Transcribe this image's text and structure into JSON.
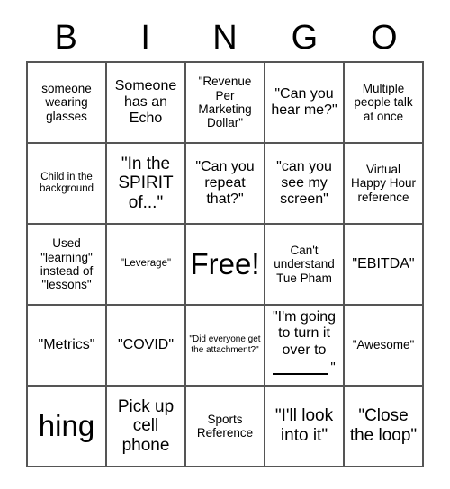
{
  "card": {
    "header_letters": [
      "B",
      "I",
      "N",
      "G",
      "O"
    ],
    "rows": [
      [
        {
          "text": "someone wearing glasses",
          "size": "md"
        },
        {
          "text": "Someone has an Echo",
          "size": "lg"
        },
        {
          "text": "\"Revenue Per Marketing Dollar\"",
          "size": "md"
        },
        {
          "text": "\"Can you hear me?\"",
          "size": "lg"
        },
        {
          "text": "Multiple people talk at once",
          "size": "md"
        }
      ],
      [
        {
          "text": "Child in the background",
          "size": "sm"
        },
        {
          "text": "\"In the SPIRIT of...\"",
          "size": "xl"
        },
        {
          "text": "\"Can you repeat that?\"",
          "size": "lg"
        },
        {
          "text": "\"can you see my screen\"",
          "size": "lg"
        },
        {
          "text": "Virtual Happy Hour reference",
          "size": "md"
        }
      ],
      [
        {
          "text": "Used \"learning\" instead of \"lessons\"",
          "size": "md"
        },
        {
          "text": "\"Leverage\"",
          "size": "sm"
        },
        {
          "text": "Free!",
          "size": "huge"
        },
        {
          "text": "Can't understand Tue Pham",
          "size": "md"
        },
        {
          "text": "\"EBITDA\"",
          "size": "lg"
        }
      ],
      [
        {
          "text": "\"Metrics\"",
          "size": "lg"
        },
        {
          "text": "\"COVID\"",
          "size": "lg"
        },
        {
          "text": "\"Did everyone get the attachment?\"",
          "size": "xs"
        },
        {
          "text": "\"I'm going to turn it over to",
          "size": "lg",
          "kind": "fill-in-blank",
          "trailing_quote": "\""
        },
        {
          "text": "\"Awesome\"",
          "size": "md"
        }
      ],
      [
        {
          "text": "hing",
          "size": "huge"
        },
        {
          "text": "Pick up cell phone",
          "size": "xl"
        },
        {
          "text": "Sports Reference",
          "size": "md"
        },
        {
          "text": "\"I'll look into it\"",
          "size": "xl"
        },
        {
          "text": "\"Close the loop\"",
          "size": "xl"
        }
      ]
    ]
  },
  "colors": {
    "grid_line": "#555555",
    "text": "#000000",
    "background": "#ffffff"
  }
}
